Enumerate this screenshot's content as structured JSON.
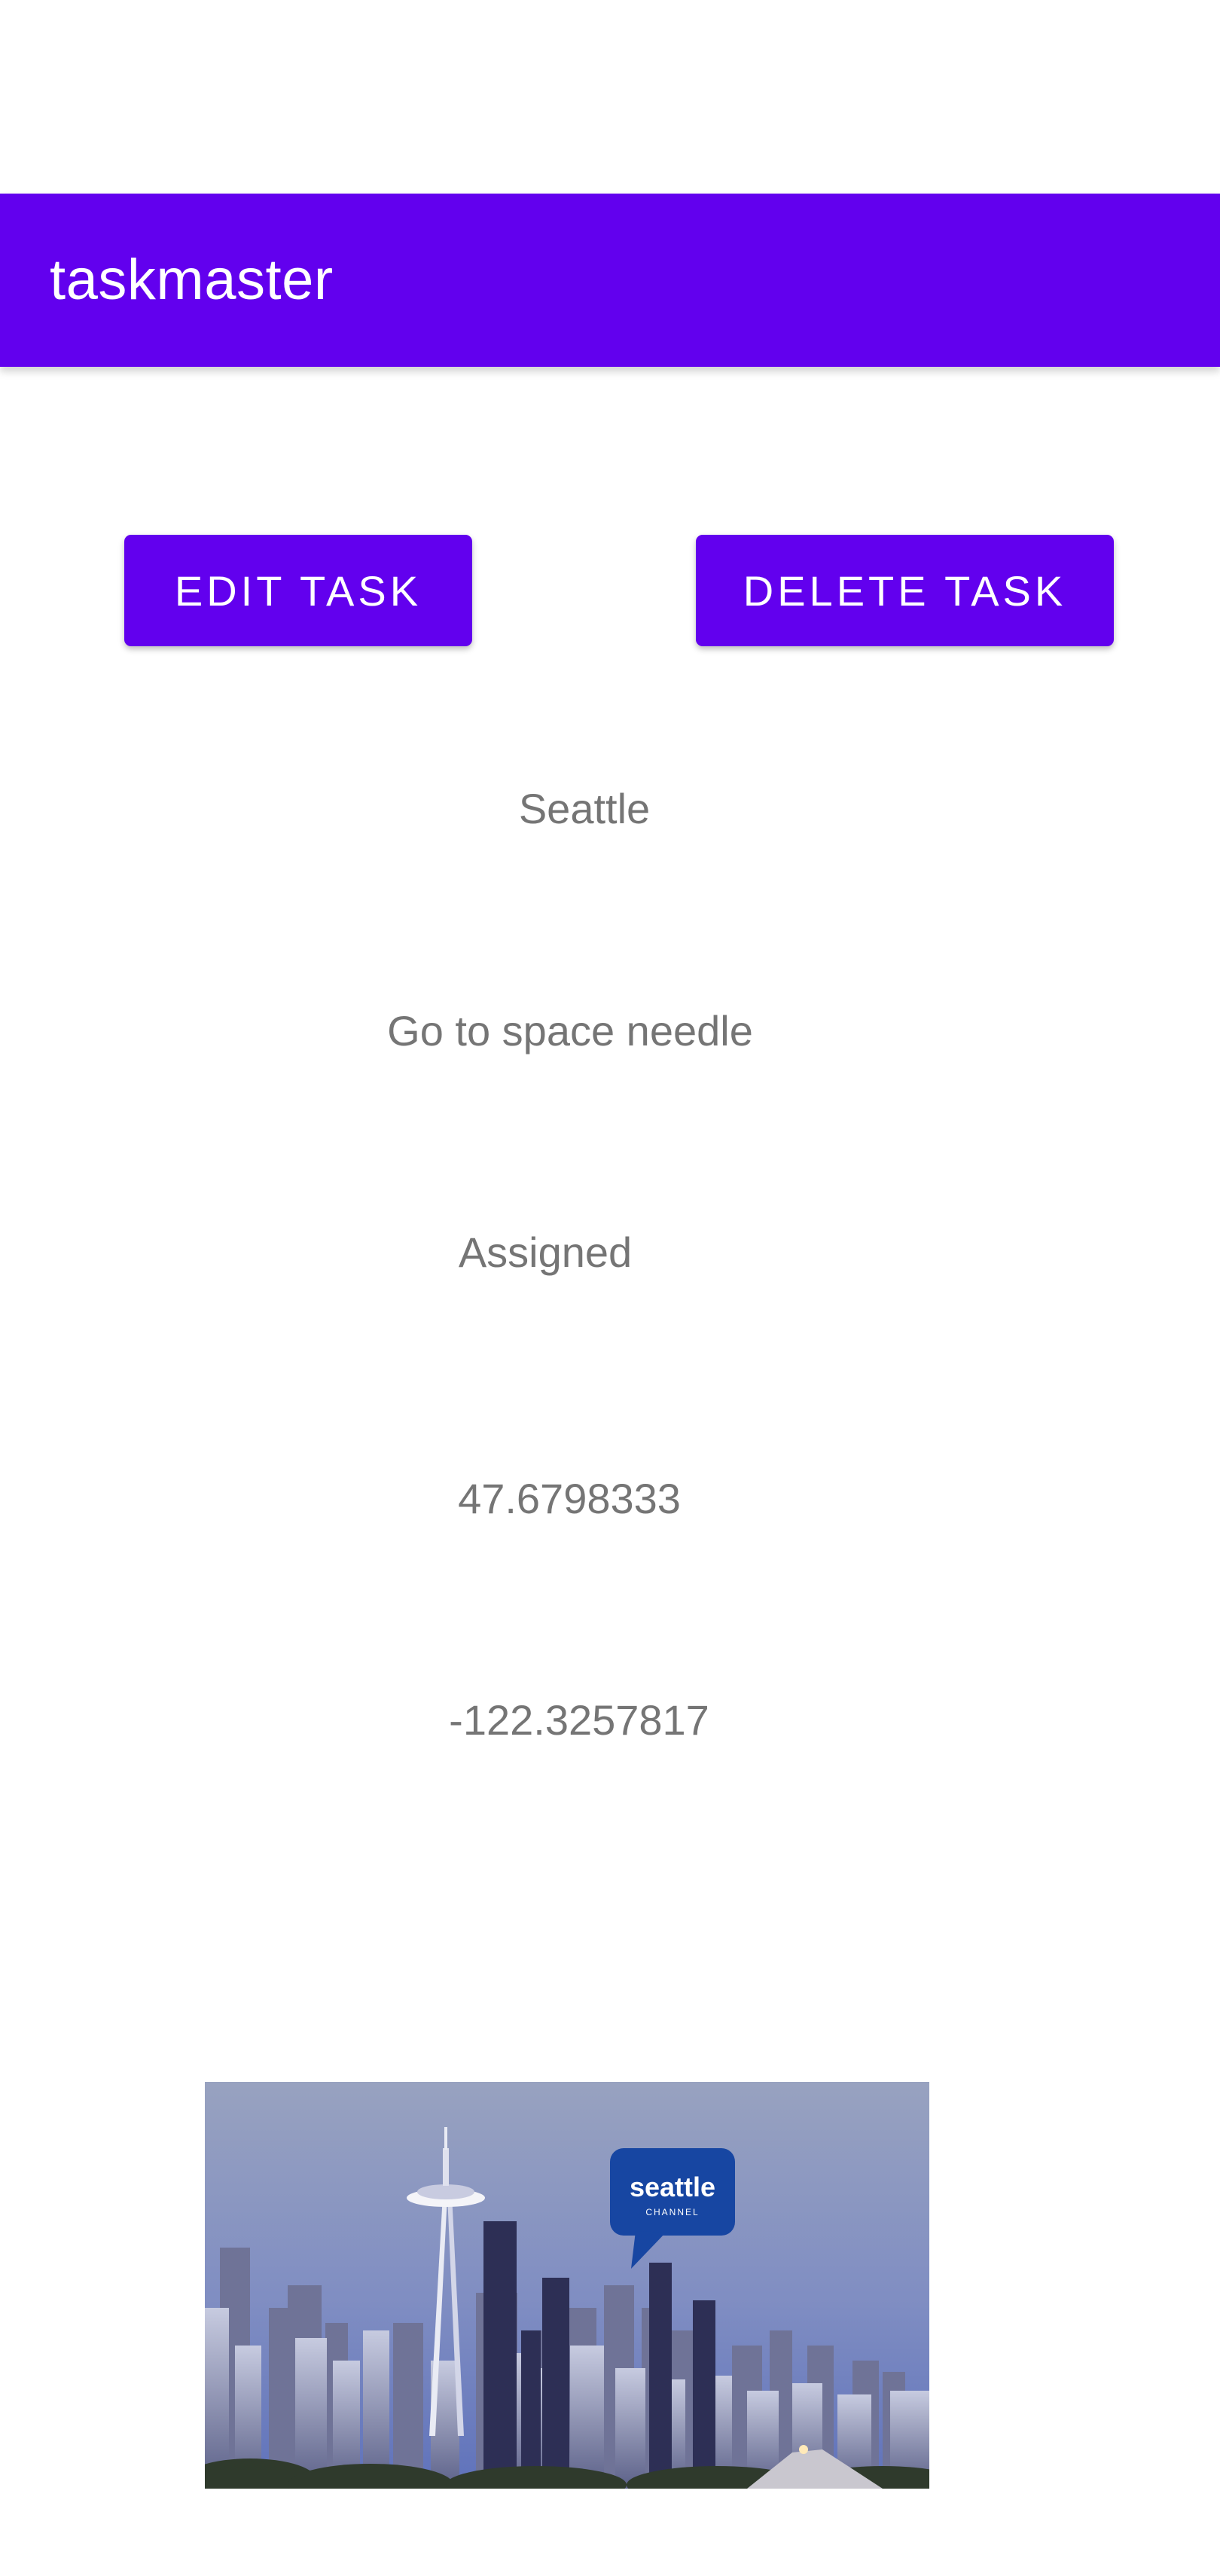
{
  "app_bar": {
    "title": "taskmaster"
  },
  "actions": {
    "edit_label": "EDIT TASK",
    "delete_label": "DELETE TASK"
  },
  "task": {
    "title": "Seattle",
    "body": "Go to space needle",
    "state": "Assigned",
    "latitude": "47.6798333",
    "longitude": "-122.3257817"
  },
  "image": {
    "logo_text": "seattle",
    "logo_subtext": "CHANNEL"
  },
  "colors": {
    "primary": "#6200ee",
    "on_primary": "#ffffff",
    "detail_text": "#757575",
    "background": "#ffffff"
  }
}
